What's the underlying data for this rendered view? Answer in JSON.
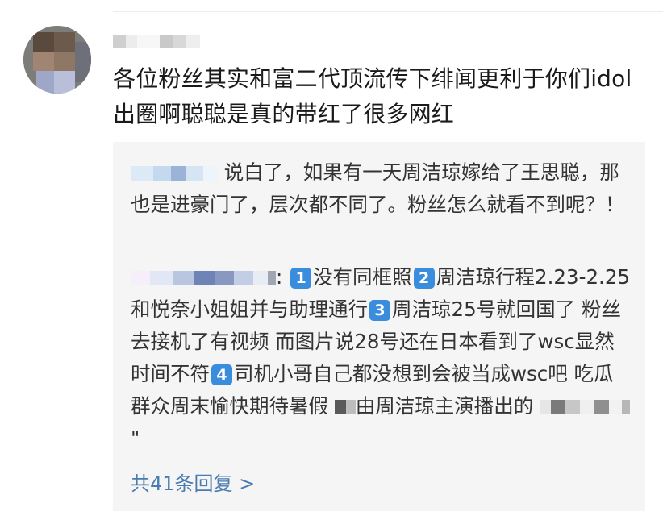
{
  "comment": {
    "text": "各位粉丝其实和富二代顶流传下绯闻更利于你们idol出圈啊聪聪是真的带红了很多网红"
  },
  "replies": [
    {
      "text": "说白了，如果有一天周洁琼嫁给了王思聪，那也是进豪门了，层次都不同了。粉丝怎么就看不到呢？！"
    },
    {
      "colon": ":",
      "badges": [
        "1",
        "2",
        "3",
        "4"
      ],
      "seg1": "没有同框照",
      "seg2": "周洁琼行程2.23-2.25和悦奈小姐姐并与助理通行",
      "seg3": "周洁琼25号就回国了 粉丝去接机了有视频 而图片说28号还在日本看到了wsc显然时间不符",
      "seg4": "司机小哥自己都没想到会被当成wsc吧 吃瓜群众周末愉快期待暑假",
      "seg5": "由周洁琼主演播出的",
      "tail": "\""
    }
  ],
  "more_replies_label": "共41条回复 >",
  "colors": {
    "link": "#4a7bb0",
    "badge": "#3a8ddc",
    "reply_bg": "#f5f5f5"
  }
}
